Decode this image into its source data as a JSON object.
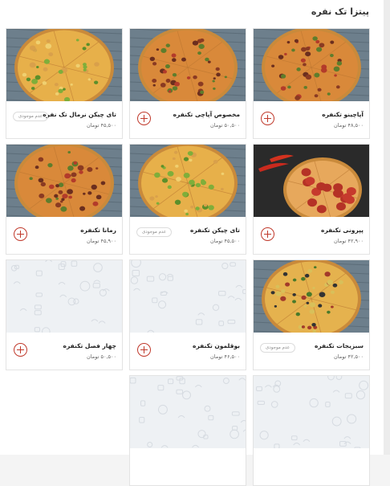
{
  "section_title": "پیتزا تک نفره",
  "products": [
    {
      "name": "آپاچینو تکنفره",
      "price": "۴۸,۵۰۰ تومان",
      "status": "add",
      "image": "pizza-meat"
    },
    {
      "name": "مخصوص آپاچی تکنفره",
      "price": "۵۰,۵۰۰ تومان",
      "status": "add",
      "image": "pizza-meat"
    },
    {
      "name": "تای چیکن نرمال تک نفره",
      "price": "۴۵,۵۰۰ تومان",
      "status": "unavailable",
      "image": "pizza-veg"
    },
    {
      "name": "پپرونی تکنفره",
      "price": "۴۲,۹۰۰ تومان",
      "status": "add",
      "image": "pizza-pepperoni"
    },
    {
      "name": "تای چیکن تکنفره",
      "price": "۴۵,۵۰۰ تومان",
      "status": "unavailable",
      "image": "pizza-veg"
    },
    {
      "name": "رمانا تکنفره",
      "price": "۴۵,۹۰۰ تومان",
      "status": "add",
      "image": "pizza-meat"
    },
    {
      "name": "سبزیجات تکنفره",
      "price": "۴۲,۵۰۰ تومان",
      "status": "unavailable",
      "image": "pizza-vegetable"
    },
    {
      "name": "بوقلمون تکنفره",
      "price": "۴۶,۵۰۰ تومان",
      "status": "add",
      "image": "placeholder-pattern"
    },
    {
      "name": "چهار فصل تکنفره",
      "price": "۵۰,۵۰۰ تومان",
      "status": "add",
      "image": "placeholder-pattern"
    },
    {
      "name": "",
      "price": "",
      "status": "",
      "image": "placeholder-pattern"
    },
    {
      "name": "",
      "price": "",
      "status": "",
      "image": "placeholder-pattern"
    }
  ],
  "unavailable_label": "عدم موجودی",
  "colors": {
    "accent": "#c0392b",
    "border": "#e3e3e3",
    "text": "#222222"
  }
}
